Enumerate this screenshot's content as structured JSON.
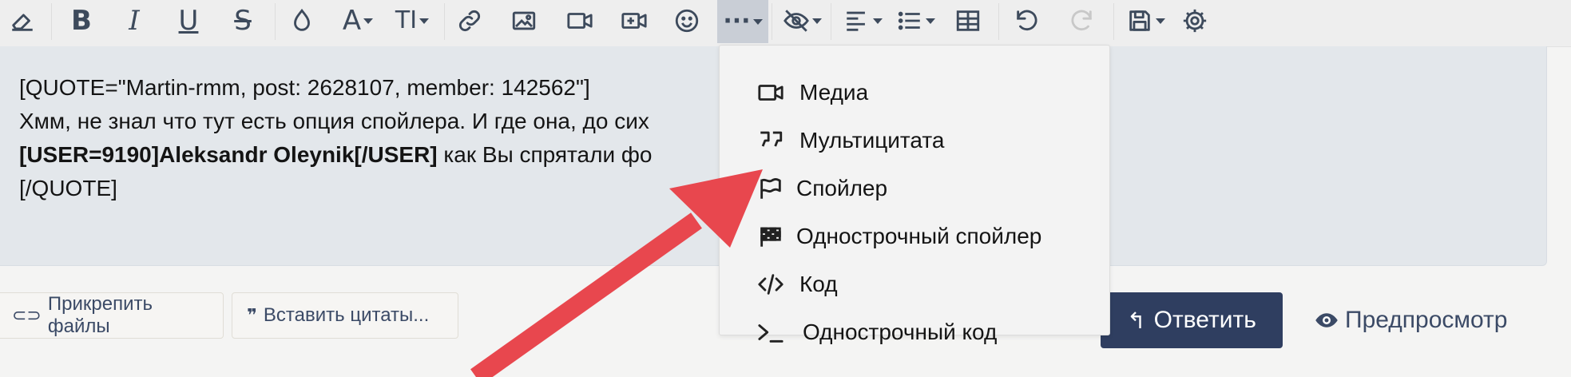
{
  "toolbar": {
    "buttons": [
      {
        "name": "eraser-icon",
        "glyph": ""
      },
      {
        "name": "bold-icon",
        "glyph": "B"
      },
      {
        "name": "italic-icon",
        "glyph": "I"
      },
      {
        "name": "underline-icon",
        "glyph": "U"
      },
      {
        "name": "strikethrough-icon",
        "glyph": "S"
      },
      {
        "name": "color-drop-icon",
        "glyph": ""
      },
      {
        "name": "font-icon",
        "glyph": "A"
      },
      {
        "name": "text-size-icon",
        "glyph": "TI"
      },
      {
        "name": "link-icon",
        "glyph": ""
      },
      {
        "name": "image-icon",
        "glyph": ""
      },
      {
        "name": "video-icon",
        "glyph": ""
      },
      {
        "name": "media-add-icon",
        "glyph": ""
      },
      {
        "name": "smiley-icon",
        "glyph": ""
      },
      {
        "name": "more-icon",
        "glyph": "···"
      },
      {
        "name": "hide-icon",
        "glyph": ""
      },
      {
        "name": "align-icon",
        "glyph": ""
      },
      {
        "name": "list-icon",
        "glyph": ""
      },
      {
        "name": "table-icon",
        "glyph": ""
      },
      {
        "name": "undo-icon",
        "glyph": ""
      },
      {
        "name": "redo-icon",
        "glyph": ""
      },
      {
        "name": "save-draft-icon",
        "glyph": ""
      },
      {
        "name": "settings-icon",
        "glyph": ""
      }
    ]
  },
  "editor": {
    "line1": "[QUOTE=\"Martin-rmm, post: 2628107, member: 142562\"]",
    "line2": "Хмм, не знал что тут есть опция спойлера. И где она, до сих",
    "line3_bold": "[USER=9190]Aleksandr Oleynik[/USER]",
    "line3_rest": " как Вы спрятали фо",
    "line4": "[/QUOTE]"
  },
  "menu": {
    "items": [
      {
        "label": "Медиа",
        "icon": "video-icon"
      },
      {
        "label": "Мультицитата",
        "icon": "quote-icon"
      },
      {
        "label": "Спойлер",
        "icon": "flag-icon"
      },
      {
        "label": "Однострочный спойлер",
        "icon": "checkered-flag-icon"
      },
      {
        "label": "Код",
        "icon": "code-icon"
      },
      {
        "label": "Однострочный код",
        "icon": "terminal-icon"
      }
    ]
  },
  "footer": {
    "attach_label": "Прикрепить файлы",
    "insert_quotes_label": "Вставить цитаты...",
    "reply_label": "Ответить",
    "preview_label": "Предпросмотр"
  },
  "colors": {
    "primary": "#2f3e60",
    "link": "#3b4a66",
    "annotation_arrow": "#e8474e",
    "active_toolbar": "#c9ced6"
  }
}
